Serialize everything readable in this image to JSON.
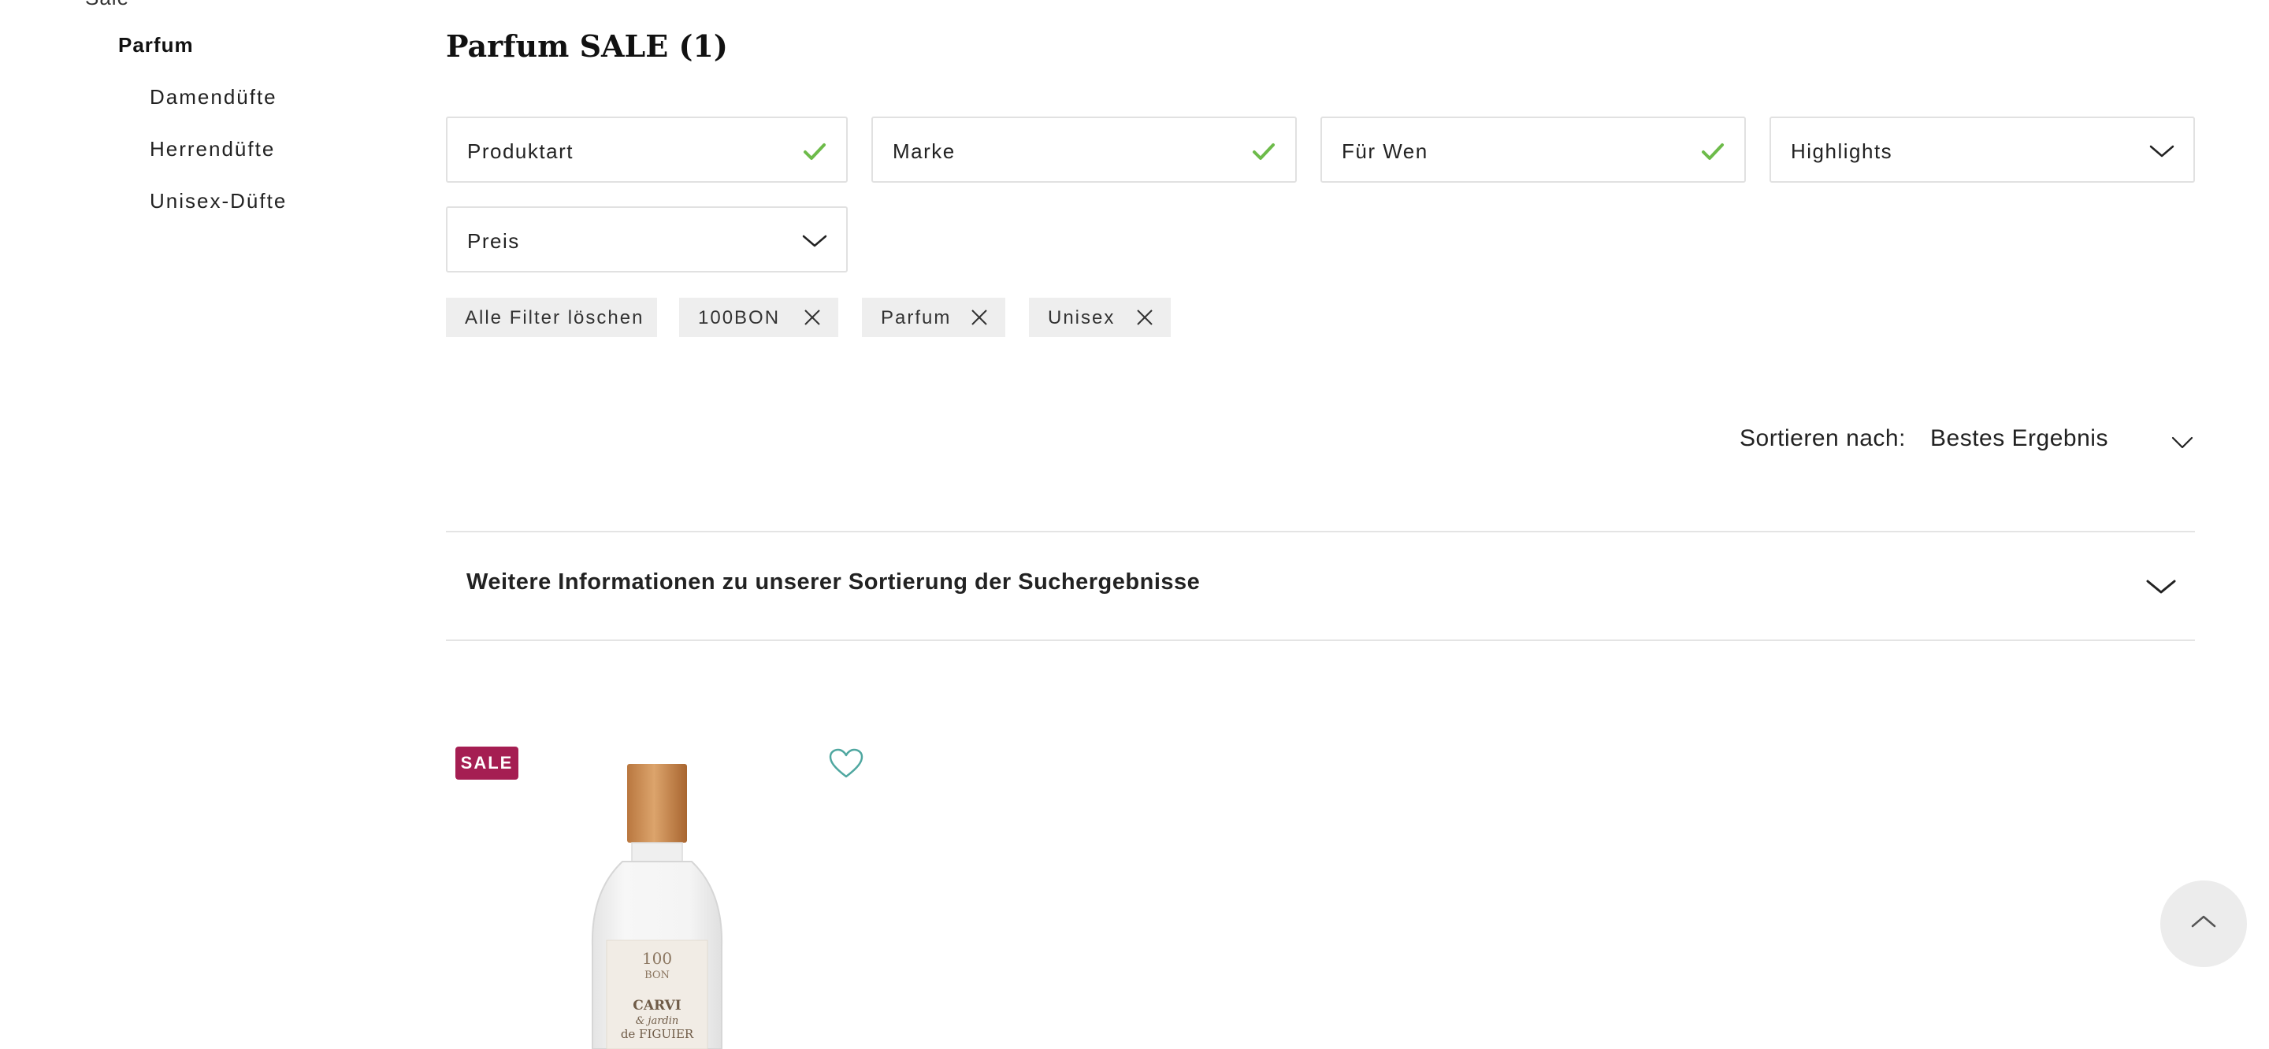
{
  "sidebar": {
    "parent_label": "Sale",
    "active_label": "Parfum",
    "items": [
      {
        "label": "Damendüfte"
      },
      {
        "label": "Herrendüfte"
      },
      {
        "label": "Unisex-Düfte"
      }
    ]
  },
  "page": {
    "title": "Parfum SALE (1)"
  },
  "filters": [
    {
      "label": "Produktart",
      "state": "selected",
      "icon": "check-icon"
    },
    {
      "label": "Marke",
      "state": "selected",
      "icon": "check-icon"
    },
    {
      "label": "Für Wen",
      "state": "selected",
      "icon": "check-icon"
    },
    {
      "label": "Highlights",
      "state": "collapsed",
      "icon": "chevron-down-icon"
    },
    {
      "label": "Preis",
      "state": "collapsed",
      "icon": "chevron-down-icon"
    }
  ],
  "active_filters": {
    "clear_all_label": "Alle Filter löschen",
    "chips": [
      {
        "label": "100BON"
      },
      {
        "label": "Parfum"
      },
      {
        "label": "Unisex"
      }
    ]
  },
  "sort": {
    "label": "Sortieren nach:",
    "selected": "Bestes Ergebnis"
  },
  "info_accordion": {
    "label": "Weitere Informationen zu unserer Sortierung der Suchergebnisse"
  },
  "product": {
    "badge": "SALE",
    "bottle_label": {
      "brand_line1": "100",
      "brand_line2": "BON",
      "name_line1": "CARVI",
      "name_line2": "& jardin",
      "name_line3": "de FIGUIER"
    }
  },
  "colors": {
    "check": "#6dbb4a",
    "sale_badge": "#a51e52",
    "wishlist_heart": "#4fa7a0",
    "chip_bg": "#eeeeee",
    "border": "#e1e1e1"
  }
}
